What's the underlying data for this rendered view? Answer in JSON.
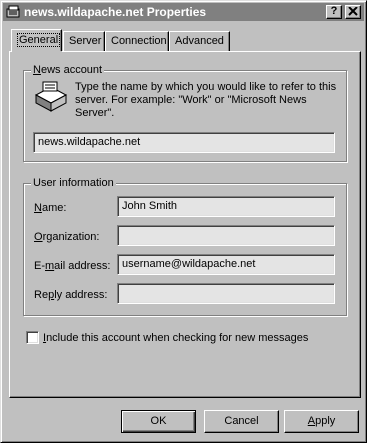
{
  "window": {
    "title": "news.wildapache.net Properties",
    "help_button": "?",
    "close_button": "✕"
  },
  "tabs": [
    {
      "label": "General",
      "active": true
    },
    {
      "label": "Server",
      "active": false
    },
    {
      "label": "Connection",
      "active": false
    },
    {
      "label": "Advanced",
      "active": false
    }
  ],
  "news_account": {
    "group_label_pre": "",
    "group_label_access": "N",
    "group_label_post": "ews account",
    "description": "Type the name by which you would like to refer to this server.  For example: \"Work\" or \"Microsoft News Server\".",
    "account_name": "news.wildapache.net"
  },
  "user_information": {
    "group_label": "User information",
    "name_label_access": "N",
    "name_label_rest": "ame:",
    "name_value": "John Smith",
    "organization_label_access": "O",
    "organization_label_rest": "rganization:",
    "organization_value": "",
    "email_label_pre": "E-",
    "email_label_access": "m",
    "email_label_post": "ail address:",
    "email_value": "username@wildapache.net",
    "reply_label_pre": "Re",
    "reply_label_access": "p",
    "reply_label_post": "ly address:",
    "reply_value": ""
  },
  "include_checkbox": {
    "label_access": "I",
    "label_rest": "nclude this account when checking for new messages",
    "checked": false
  },
  "buttons": {
    "ok": "OK",
    "cancel": "Cancel",
    "apply_access": "A",
    "apply_rest": "pply"
  }
}
